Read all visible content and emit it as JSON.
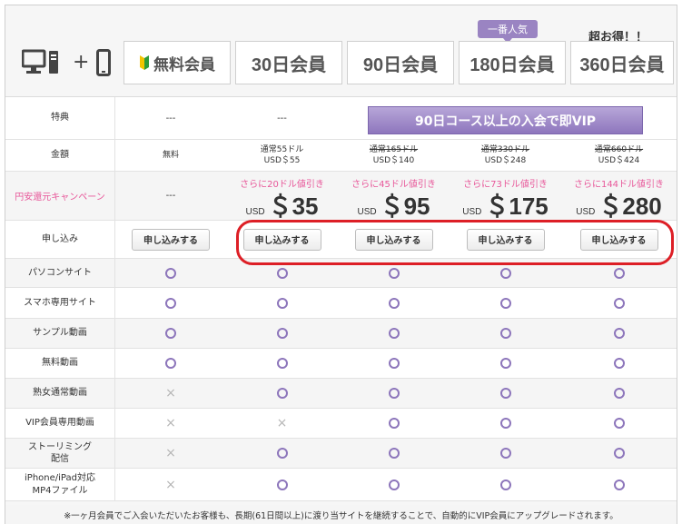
{
  "header": {
    "plans": [
      "無料会員",
      "30日会員",
      "90日会員",
      "180日会員",
      "360日会員"
    ],
    "badge": "一番人気",
    "best_deal": "超お得！！",
    "plus": "+"
  },
  "rows": {
    "tokuten": {
      "label": "特典",
      "free": "---",
      "d30": "---",
      "vip_bar": "90日コース以上の入会で即VIP"
    },
    "kingaku": {
      "label": "金額",
      "free": "無料",
      "d30": {
        "line1": "通常55ドル",
        "line2": "USD＄55"
      },
      "d90": {
        "line1": "通常165ドル",
        "line2": "USD＄140"
      },
      "d180": {
        "line1": "通常330ドル",
        "line2": "USD＄248"
      },
      "d360": {
        "line1": "通常660ドル",
        "line2": "USD＄424"
      }
    },
    "campaign": {
      "label": "円安還元キャンペーン",
      "free": "---",
      "usd": "USD",
      "items": [
        {
          "discount": "さらに20ドル値引き",
          "amount": "＄35"
        },
        {
          "discount": "さらに45ドル値引き",
          "amount": "＄95"
        },
        {
          "discount": "さらに73ドル値引き",
          "amount": "＄175"
        },
        {
          "discount": "さらに144ドル値引き",
          "amount": "＄280"
        }
      ]
    },
    "apply": {
      "label": "申し込み",
      "button": "申し込みする"
    }
  },
  "features": [
    {
      "label": "パソコンサイト",
      "values": [
        true,
        true,
        true,
        true,
        true
      ]
    },
    {
      "label": "スマホ専用サイト",
      "values": [
        true,
        true,
        true,
        true,
        true
      ]
    },
    {
      "label": "サンプル動画",
      "values": [
        true,
        true,
        true,
        true,
        true
      ]
    },
    {
      "label": "無料動画",
      "values": [
        true,
        true,
        true,
        true,
        true
      ]
    },
    {
      "label": "熟女通常動画",
      "values": [
        false,
        true,
        true,
        true,
        true
      ]
    },
    {
      "label": "VIP会員専用動画",
      "values": [
        false,
        false,
        true,
        true,
        true
      ]
    },
    {
      "label": "ストーリミング\n配信",
      "values": [
        false,
        true,
        true,
        true,
        true
      ]
    },
    {
      "label": "iPhone/iPad対応\nMP4ファイル",
      "values": [
        false,
        true,
        true,
        true,
        true
      ]
    }
  ],
  "symbols": {
    "yes": "○",
    "no": "×"
  },
  "footnote": "※一ヶ月会員でご入会いただいたお客様も、長期(61日間以上)に渡り当サイトを継続することで、自動的にVIP会員にアップグレードされます。",
  "colors": {
    "accent": "#8d76bb",
    "campaign": "#e8589a",
    "highlight": "#dd1f26"
  }
}
